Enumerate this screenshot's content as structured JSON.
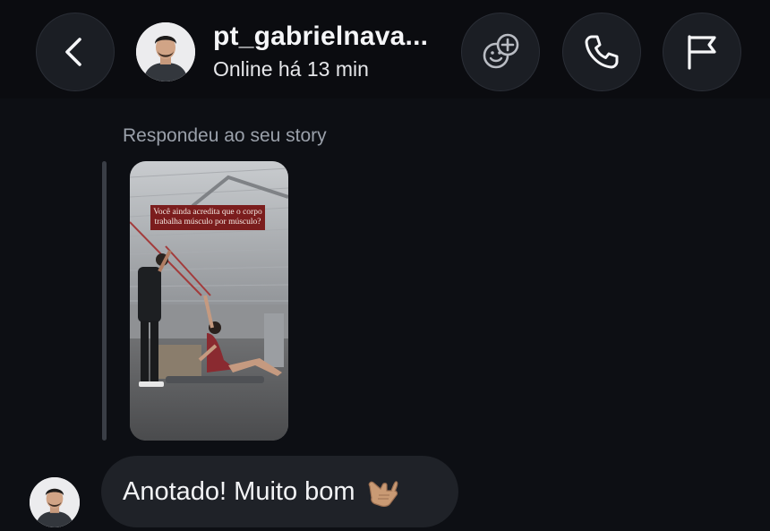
{
  "header": {
    "username": "pt_gabrielnava...",
    "status": "Online há 13 min",
    "buttons": {
      "back": "chevron-left-icon",
      "effects": "sticker-effects-icon",
      "call": "phone-icon",
      "report": "flag-icon"
    }
  },
  "conversation": {
    "reply_label": "Respondeu ao seu story",
    "story": {
      "caption": "Você ainda acredita que o corpo trabalha músculo por músculo?"
    },
    "message": {
      "text": "Anotado! Muito bom",
      "emoji": "call-me-hand-emoji"
    }
  },
  "colors": {
    "background": "#0d0f14",
    "bubble": "#1f2228",
    "secondary_text": "#9aa0aa",
    "caption_bg": "#7b1d1d"
  }
}
